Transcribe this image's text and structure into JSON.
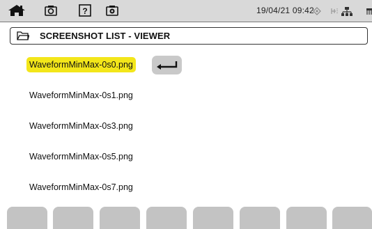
{
  "status_bar": {
    "datetime": "19/04/21 09:42",
    "icons": [
      "home-icon",
      "screenshot-icon",
      "help-icon",
      "screenshot-settings-icon",
      "power-icon",
      "battery-icon",
      "network-icon",
      "memory-icon"
    ]
  },
  "header": {
    "icon": "folder-icon",
    "title": "SCREENSHOT LIST - VIEWER"
  },
  "files": [
    {
      "name": "WaveformMinMax-0s0.png",
      "selected": true
    },
    {
      "name": "WaveformMinMax-0s1.png",
      "selected": false
    },
    {
      "name": "WaveformMinMax-0s3.png",
      "selected": false
    },
    {
      "name": "WaveformMinMax-0s5.png",
      "selected": false
    },
    {
      "name": "WaveformMinMax-0s7.png",
      "selected": false
    }
  ],
  "enter_button": {
    "icon": "enter-return-icon"
  },
  "colors": {
    "selection": "#f3e61a",
    "bar": "#d9d9d9",
    "softkey": "#c3c3c3"
  }
}
